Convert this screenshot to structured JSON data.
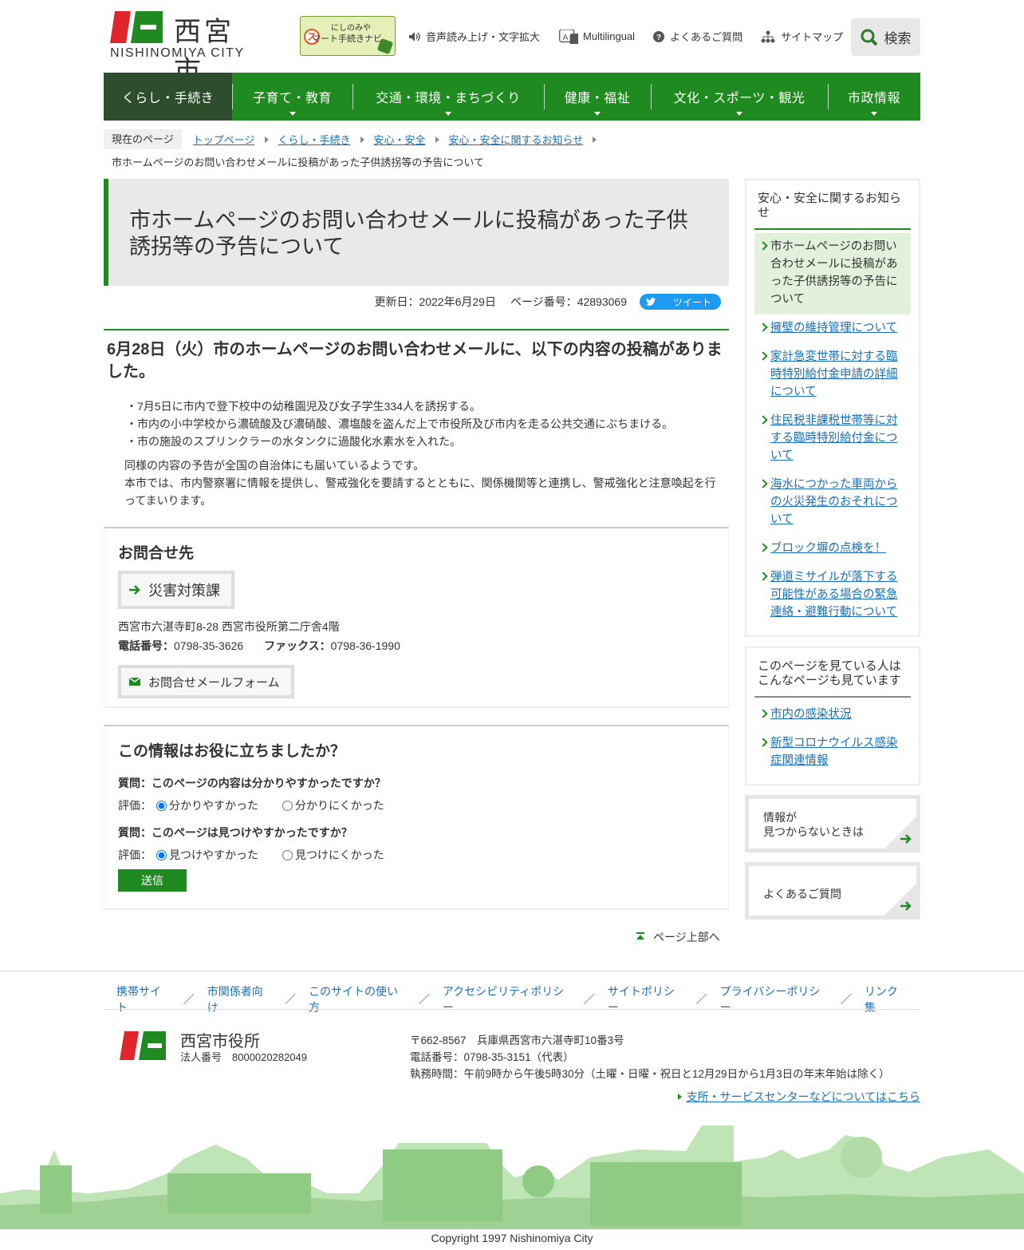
{
  "header": {
    "logo_ja": "西宮市",
    "logo_en": "NISHINOMIYA CITY",
    "navi_line1": "にしのみや",
    "navi_line2": "マート手続きナビ",
    "navi_s": "ス",
    "links": [
      {
        "label": "音声読み上げ・文字拡大",
        "icon": "speaker-icon"
      },
      {
        "label": "Multilingual",
        "icon": "translate-icon"
      },
      {
        "label": "よくあるご質問",
        "icon": "question-icon"
      },
      {
        "label": "サイトマップ",
        "icon": "sitemap-icon"
      }
    ],
    "search_label": "検索"
  },
  "gnav": [
    {
      "label": "くらし・手続き",
      "active": true
    },
    {
      "label": "子育て・教育"
    },
    {
      "label": "交通・環境・まちづくり"
    },
    {
      "label": "健康・福祉"
    },
    {
      "label": "文化・スポーツ・観光"
    },
    {
      "label": "市政情報"
    }
  ],
  "breadcrumb": {
    "here": "現在のページ",
    "items": [
      "トップページ",
      "くらし・手続き",
      "安心・安全",
      "安心・安全に関するお知らせ"
    ],
    "current": "市ホームページのお問い合わせメールに投稿があった子供誘拐等の予告について"
  },
  "main": {
    "title": "市ホームページのお問い合わせメールに投稿があった子供誘拐等の予告について",
    "updated": "更新日：2022年6月29日",
    "page_no": "ページ番号：42893069",
    "tweet": "ツイート",
    "heading": "6月28日（火）市のホームページのお問い合わせメールに、以下の内容の投稿がありました。",
    "bullets": [
      "・7月5日に市内で登下校中の幼稚園児及び女子学生334人を誘拐する。",
      "・市内の小中学校から濃硫酸及び濃硝酸、濃塩酸を盗んだ上で市役所及び市内を走る公共交通にぶちまける。",
      "・市の施設のスプリンクラーの水タンクに過酸化水素水を入れた。"
    ],
    "para1": "同様の内容の予告が全国の自治体にも届いているようです。",
    "para2": "本市では、市内警察署に情報を提供し、警戒強化を要請するとともに、関係機関等と連携し、警戒強化と注意喚起を行ってまいります。"
  },
  "contact": {
    "heading": "お問合せ先",
    "dept": "災害対策課",
    "address": "西宮市六湛寺町8-28 西宮市役所第二庁舎4階",
    "tel_label": "電話番号：",
    "tel": "0798-35-3626",
    "fax_label": "ファックス：",
    "fax": "0798-36-1990",
    "mail": "お問合せメールフォーム"
  },
  "survey": {
    "heading": "この情報はお役に立ちましたか？",
    "q1": "質問：このページの内容は分かりやすかったですか？",
    "q1_eval": "評価：",
    "q1_opt1": "分かりやすかった",
    "q1_opt2": "分かりにくかった",
    "q2": "質問：このページは見つけやすかったですか？",
    "q2_eval": "評価：",
    "q2_opt1": "見つけやすかった",
    "q2_opt2": "見つけにくかった",
    "send": "送信"
  },
  "pagetop": "ページ上部へ",
  "sidebar": {
    "box1_title": "安心・安全に関するお知らせ",
    "box1_current": "市ホームページのお問い合わせメールに投稿があった子供誘拐等の予告について",
    "box1_items": [
      "擁壁の維持管理について",
      "家計急変世帯に対する臨時特別給付金申請の詳細について",
      "住民税非課税世帯等に対する臨時特別給付金について",
      "海水につかった車両からの火災発生のおそれについて",
      "ブロック塀の点検を！",
      "弾道ミサイルが落下する可能性がある場合の緊急連絡・避難行動について"
    ],
    "box2_title": "このページを見ている人はこんなページも見ています",
    "box2_items": [
      "市内の感染状況",
      "新型コロナウイルス感染症関連情報"
    ],
    "banner1_l1": "情報が",
    "banner1_l2": "見つからないときは",
    "banner2": "よくあるご質問"
  },
  "footer": {
    "links": [
      "携帯サイト",
      "市関係者向け",
      "このサイトの使い方",
      "アクセシビリティポリシー",
      "サイトポリシー",
      "プライバシーポリシー",
      "リンク集"
    ],
    "sep": "／",
    "org": "西宮市役所",
    "corp_no": "法人番号　8000020282049",
    "addr": "〒662-8567　兵庫県西宮市六湛寺町10番3号",
    "tel": "電話番号：0798-35-3151（代表）",
    "hours": "執務時間：午前9時から午後5時30分（土曜・日曜・祝日と12月29日から1月3日の年末年始は除く）",
    "branch": "支所・サービスセンターなどについてはこちら",
    "copyright": "Copyright 1997 Nishinomiya City"
  },
  "colors": {
    "brand_green": "#1f8a1f",
    "nav_active": "#2d4d2d",
    "link": "#1b6fb5",
    "logo_red": "#e0262a"
  }
}
